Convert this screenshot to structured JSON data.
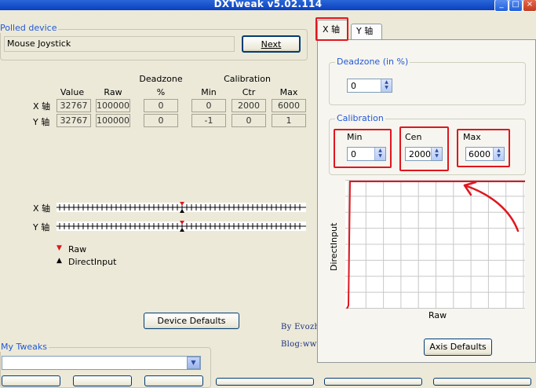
{
  "window": {
    "title": "DXTweak v5.02.114"
  },
  "polled": {
    "legend": "Polled device",
    "device": "Mouse Joystick",
    "next_label": "Next"
  },
  "readout": {
    "headers": {
      "value": "Value",
      "raw": "Raw",
      "deadzone": "Deadzone",
      "deadzone_unit": "%",
      "calibration": "Calibration",
      "min": "Min",
      "ctr": "Ctr",
      "max": "Max"
    },
    "rows": [
      {
        "label": "X 轴",
        "value": "32767",
        "raw": "100000",
        "deadzone": "0",
        "min": "0",
        "ctr": "2000",
        "max": "6000"
      },
      {
        "label": "Y 轴",
        "value": "32767",
        "raw": "100000",
        "deadzone": "0",
        "min": "-1",
        "ctr": "0",
        "max": "1"
      }
    ]
  },
  "sliders": {
    "x_label": "X 轴",
    "y_label": "Y 轴",
    "x_position": 0.5,
    "y_position": 0.5,
    "raw_color": "#e0161e",
    "directinput_color": "#000000"
  },
  "legend_items": {
    "raw": "Raw",
    "directinput": "DirectInput"
  },
  "device_defaults_label": "Device Defaults",
  "tweaks": {
    "legend": "My Tweaks",
    "selected": ""
  },
  "tabs": {
    "x_tab": "X 轴",
    "y_tab": "Y 轴",
    "active": "X 轴"
  },
  "axis_panel": {
    "deadzone_legend": "Deadzone (in %)",
    "deadzone_value": "0",
    "calibration_legend": "Calibration",
    "min_label": "Min",
    "min_value": "0",
    "cen_label": "Cen",
    "cen_value": "2000",
    "max_label": "Max",
    "max_value": "6000",
    "graph_ylabel": "DirectInput",
    "graph_xlabel": "Raw",
    "axis_defaults_label": "Axis Defaults"
  },
  "signature": {
    "by": "By Evozhui",
    "blog": "Blog:www.kulysa.kpsky.cn"
  },
  "colors": {
    "title_bar": "#0a3fbf",
    "legend_text": "#2259d6",
    "annotation_red": "#e0161e"
  },
  "icons": {
    "minimize": "minimize-icon",
    "maximize": "maximize-icon",
    "close": "close-icon"
  }
}
